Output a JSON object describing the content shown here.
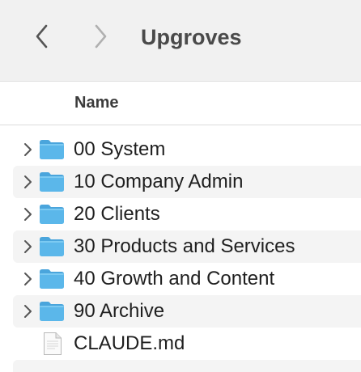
{
  "window": {
    "title": "Upgroves"
  },
  "toolbar": {
    "back_icon": "chevron-left-icon",
    "forward_icon": "chevron-right-icon"
  },
  "columns": {
    "name": "Name"
  },
  "items": [
    {
      "label": "00 System",
      "kind": "folder",
      "icon": "folder-icon",
      "expandable": true
    },
    {
      "label": "10 Company Admin",
      "kind": "folder",
      "icon": "folder-icon",
      "expandable": true
    },
    {
      "label": "20 Clients",
      "kind": "folder",
      "icon": "folder-icon",
      "expandable": true
    },
    {
      "label": "30 Products and Services",
      "kind": "folder",
      "icon": "folder-icon",
      "expandable": true
    },
    {
      "label": "40 Growth and Content",
      "kind": "folder",
      "icon": "folder-icon",
      "expandable": true
    },
    {
      "label": "90 Archive",
      "kind": "folder",
      "icon": "folder-icon",
      "expandable": true
    },
    {
      "label": "CLAUDE.md",
      "kind": "file",
      "icon": "document-icon",
      "expandable": false
    }
  ],
  "colors": {
    "folder_body": "#5bb7ea",
    "folder_tab": "#4aa5dc",
    "toolbar_bg": "#f1f1f1",
    "row_stripe": "#f4f4f4"
  }
}
